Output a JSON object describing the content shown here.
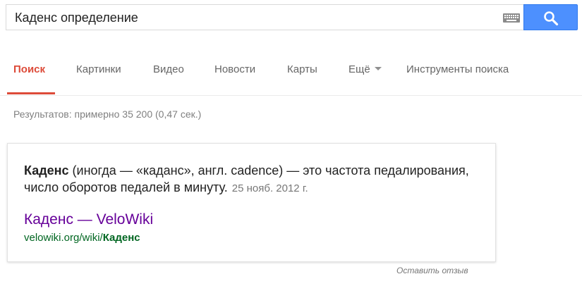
{
  "search": {
    "value": "Каденс определение",
    "keyboard_icon": "keyboard-icon",
    "button_icon": "search-icon",
    "button_color": "#4d90fe"
  },
  "tabs": [
    {
      "label": "Поиск",
      "active": true
    },
    {
      "label": "Картинки"
    },
    {
      "label": "Видео"
    },
    {
      "label": "Новости"
    },
    {
      "label": "Карты"
    },
    {
      "label": "Ещё"
    },
    {
      "label": "Инструменты поиска"
    }
  ],
  "colors": {
    "active_tab": "#dd4b39",
    "visited_link": "#660099",
    "url": "#006621"
  },
  "stats": "Результатов: примерно 35 200 (0,47 сек.)",
  "answer": {
    "term": "Каденс",
    "definition": " (иногда — «каданс», англ. cadence) — это частота педалирования, число оборотов педалей в минуту.",
    "date": "25 нояб. 2012 г."
  },
  "result": {
    "title": "Каденс — VeloWiki",
    "url_prefix": "velowiki.org/wiki/",
    "url_bold": "Каденс"
  },
  "feedback": "Оставить отзыв"
}
